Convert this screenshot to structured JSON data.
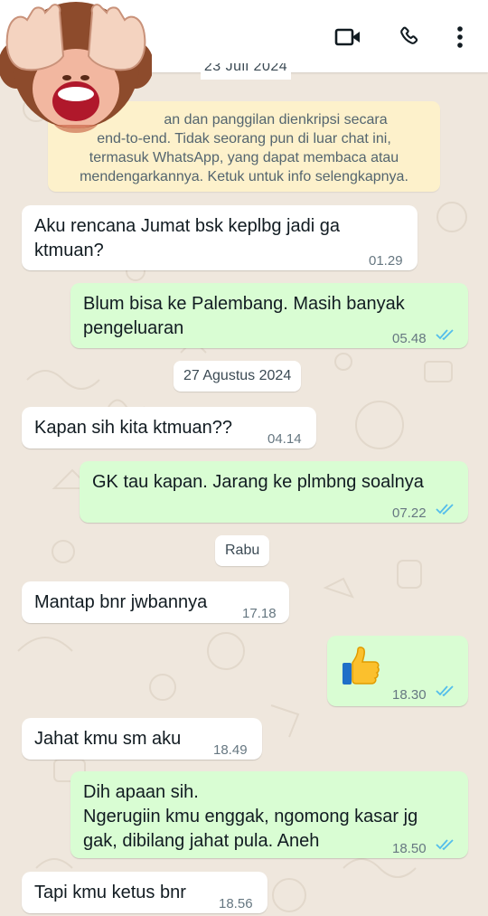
{
  "header": {
    "icons": [
      "video-call-icon",
      "voice-call-icon",
      "more-options-icon"
    ],
    "avatar": "see-no-evil-monkey-sticker"
  },
  "dates": {
    "partial_top": "23 Juli 2024",
    "aug": "27 Agustus 2024",
    "rabu": "Rabu"
  },
  "encryption_notice": {
    "line1": "an dan panggilan dienkripsi secara",
    "line2": "end-to-end. Tidak seorang pun di luar chat ini,",
    "line3": "termasuk WhatsApp, yang dapat membaca atau",
    "line4": "mendengarkannya. Ketuk untuk info selengkapnya."
  },
  "messages": [
    {
      "dir": "in",
      "text": "Aku rencana Jumat bsk keplbg jadi ga\nktmuan?",
      "time": "01.29"
    },
    {
      "dir": "out",
      "text": "Blum bisa ke Palembang. Masih banyak\npengeluaran",
      "time": "05.48"
    },
    {
      "dir": "in",
      "text": "Kapan sih kita ktmuan??",
      "time": "04.14"
    },
    {
      "dir": "out",
      "text": "GK tau kapan. Jarang ke plmbng soalnya",
      "time": "07.22"
    },
    {
      "dir": "in",
      "text": "Mantap bnr jwbannya",
      "time": "17.18"
    },
    {
      "dir": "out",
      "emoji": "thumbs-up",
      "time": "18.30"
    },
    {
      "dir": "in",
      "text": "Jahat kmu sm aku",
      "time": "18.49"
    },
    {
      "dir": "out",
      "text": "Dih apaan sih.\nNgerugiin kmu enggak, ngomong kasar jg\ngak, dibilang jahat pula. Aneh",
      "time": "18.50"
    },
    {
      "dir": "in",
      "text": "Tapi kmu ketus bnr",
      "time": "18.56"
    }
  ],
  "colors": {
    "incoming": "#ffffff",
    "outgoing": "#d9fdd3",
    "encryption_bg": "#fdf1cb",
    "read_ticks": "#53bdeb",
    "wallpaper": "#efe7dd"
  }
}
